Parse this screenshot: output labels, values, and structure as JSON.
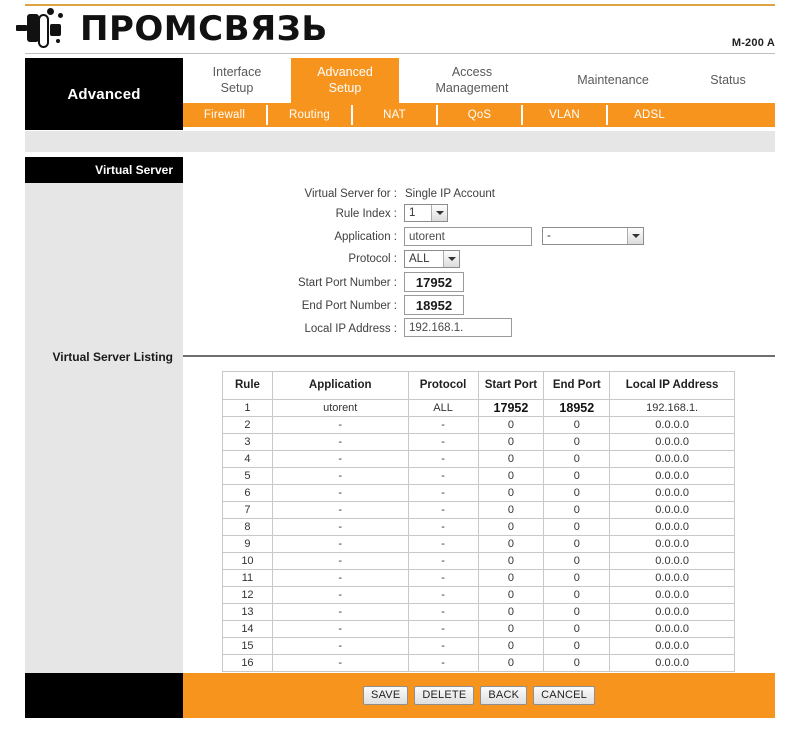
{
  "brand": {
    "logo_text": "ПРОМСВЯЗЬ",
    "logo_mark": "promsvyaz-logo-icon",
    "model": "M-200 A"
  },
  "nav": {
    "section_label": "Advanced",
    "tabs": [
      {
        "label": "Interface\nSetup",
        "line1": "Interface",
        "line2": "Setup",
        "active": false
      },
      {
        "label": "Advanced\nSetup",
        "line1": "Advanced",
        "line2": "Setup",
        "active": true
      },
      {
        "label": "Access\nManagement",
        "line1": "Access",
        "line2": "Management",
        "active": false
      },
      {
        "label": "Maintenance",
        "line1": "Maintenance",
        "line2": "",
        "active": false
      },
      {
        "label": "Status",
        "line1": "Status",
        "line2": "",
        "active": false
      }
    ],
    "subtabs": [
      {
        "label": "Firewall"
      },
      {
        "label": "Routing"
      },
      {
        "label": "NAT"
      },
      {
        "label": "QoS"
      },
      {
        "label": "VLAN"
      },
      {
        "label": "ADSL"
      }
    ]
  },
  "sidebar": {
    "title": "Virtual Server",
    "listing_label": "Virtual Server Listing"
  },
  "form": {
    "virtual_server_for_label": "Virtual Server for :",
    "virtual_server_for_value": "Single IP Account",
    "rule_index_label": "Rule Index :",
    "rule_index_value": "1",
    "application_label": "Application :",
    "application_value": "utorent",
    "application_preset_value": "-",
    "protocol_label": "Protocol :",
    "protocol_value": "ALL",
    "start_port_label": "Start Port Number :",
    "start_port_value": "17952",
    "end_port_label": "End Port Number :",
    "end_port_value": "18952",
    "local_ip_label": "Local IP Address :",
    "local_ip_value": "192.168.1."
  },
  "table": {
    "headers": [
      "Rule",
      "Application",
      "Protocol",
      "Start Port",
      "End Port",
      "Local IP Address"
    ],
    "rows": [
      {
        "rule": "1",
        "application": "utorent",
        "protocol": "ALL",
        "start_port": "17952",
        "end_port": "18952",
        "local_ip": "192.168.1.",
        "emphasized": true
      },
      {
        "rule": "2",
        "application": "-",
        "protocol": "-",
        "start_port": "0",
        "end_port": "0",
        "local_ip": "0.0.0.0",
        "emphasized": false
      },
      {
        "rule": "3",
        "application": "-",
        "protocol": "-",
        "start_port": "0",
        "end_port": "0",
        "local_ip": "0.0.0.0",
        "emphasized": false
      },
      {
        "rule": "4",
        "application": "-",
        "protocol": "-",
        "start_port": "0",
        "end_port": "0",
        "local_ip": "0.0.0.0",
        "emphasized": false
      },
      {
        "rule": "5",
        "application": "-",
        "protocol": "-",
        "start_port": "0",
        "end_port": "0",
        "local_ip": "0.0.0.0",
        "emphasized": false
      },
      {
        "rule": "6",
        "application": "-",
        "protocol": "-",
        "start_port": "0",
        "end_port": "0",
        "local_ip": "0.0.0.0",
        "emphasized": false
      },
      {
        "rule": "7",
        "application": "-",
        "protocol": "-",
        "start_port": "0",
        "end_port": "0",
        "local_ip": "0.0.0.0",
        "emphasized": false
      },
      {
        "rule": "8",
        "application": "-",
        "protocol": "-",
        "start_port": "0",
        "end_port": "0",
        "local_ip": "0.0.0.0",
        "emphasized": false
      },
      {
        "rule": "9",
        "application": "-",
        "protocol": "-",
        "start_port": "0",
        "end_port": "0",
        "local_ip": "0.0.0.0",
        "emphasized": false
      },
      {
        "rule": "10",
        "application": "-",
        "protocol": "-",
        "start_port": "0",
        "end_port": "0",
        "local_ip": "0.0.0.0",
        "emphasized": false
      },
      {
        "rule": "11",
        "application": "-",
        "protocol": "-",
        "start_port": "0",
        "end_port": "0",
        "local_ip": "0.0.0.0",
        "emphasized": false
      },
      {
        "rule": "12",
        "application": "-",
        "protocol": "-",
        "start_port": "0",
        "end_port": "0",
        "local_ip": "0.0.0.0",
        "emphasized": false
      },
      {
        "rule": "13",
        "application": "-",
        "protocol": "-",
        "start_port": "0",
        "end_port": "0",
        "local_ip": "0.0.0.0",
        "emphasized": false
      },
      {
        "rule": "14",
        "application": "-",
        "protocol": "-",
        "start_port": "0",
        "end_port": "0",
        "local_ip": "0.0.0.0",
        "emphasized": false
      },
      {
        "rule": "15",
        "application": "-",
        "protocol": "-",
        "start_port": "0",
        "end_port": "0",
        "local_ip": "0.0.0.0",
        "emphasized": false
      },
      {
        "rule": "16",
        "application": "-",
        "protocol": "-",
        "start_port": "0",
        "end_port": "0",
        "local_ip": "0.0.0.0",
        "emphasized": false
      }
    ]
  },
  "footer": {
    "buttons": [
      {
        "label": "SAVE"
      },
      {
        "label": "DELETE"
      },
      {
        "label": "BACK"
      },
      {
        "label": "CANCEL"
      }
    ]
  },
  "colors": {
    "accent_orange": "#f7941e",
    "top_rule": "#d9a441",
    "sidebar_gray": "#e6e6e6",
    "black": "#000000"
  }
}
